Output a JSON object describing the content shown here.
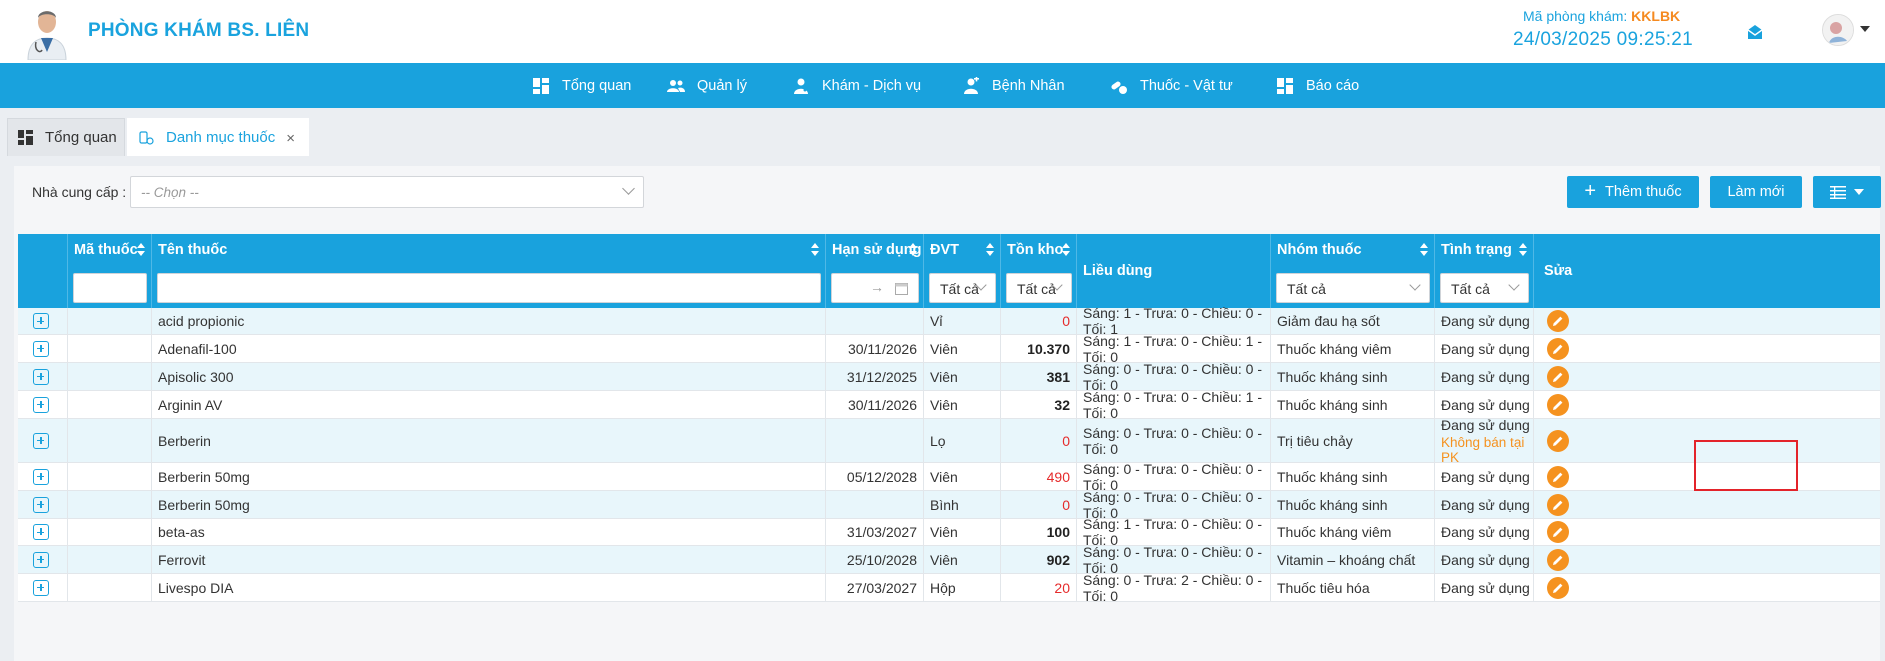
{
  "header": {
    "clinic_name": "PHÒNG KHÁM BS. LIÊN",
    "room_code_label": "Mã phòng khám: ",
    "room_code": "KKLBK",
    "datetime": "24/03/2025 09:25:21"
  },
  "nav": [
    {
      "label": "Tổng quan",
      "icon": "dashboard-icon"
    },
    {
      "label": "Quản lý",
      "icon": "users-icon"
    },
    {
      "label": "Khám - Dịch vụ",
      "icon": "doctor-icon"
    },
    {
      "label": "Bệnh Nhân",
      "icon": "patient-icon"
    },
    {
      "label": "Thuốc - Vật tư",
      "icon": "pills-icon"
    },
    {
      "label": "Báo cáo",
      "icon": "report-icon"
    }
  ],
  "tabs": {
    "overview": "Tổng quan",
    "drug_catalog": "Danh mục thuốc",
    "close": "×"
  },
  "filter": {
    "supplier_label": "Nhà cung cấp :",
    "supplier_placeholder": "-- Chọn --"
  },
  "toolbar": {
    "add_label": "Thêm thuốc",
    "refresh_label": "Làm mới"
  },
  "table": {
    "columns": {
      "code": "Mã thuốc",
      "name": "Tên thuốc",
      "expiry": "Hạn sử dụng",
      "unit": "ĐVT",
      "stock": "Tồn kho",
      "dosage": "Liều dùng",
      "group": "Nhóm thuốc",
      "status": "Tình trạng",
      "edit": "Sửa"
    },
    "filters": {
      "unit": "Tất cả",
      "stock": "Tất cả",
      "group": "Tất cả",
      "status": "Tất cả",
      "date_arrow": "→"
    },
    "rows": [
      {
        "code": "",
        "name": "acid propionic",
        "expiry": "",
        "unit": "Vỉ",
        "stock": "0",
        "dosage": "Sáng: 1 - Trưa: 0 - Chiều: 0 - Tối: 1",
        "group": "Giảm đau hạ sốt",
        "status": "Đang sử dụng",
        "status_note": ""
      },
      {
        "code": "",
        "name": "Adenafil-100",
        "expiry": "30/11/2026",
        "unit": "Viên",
        "stock": "10.370",
        "dosage": "Sáng: 1 - Trưa: 0 - Chiều: 1 - Tối: 0",
        "group": "Thuốc kháng viêm",
        "status": "Đang sử dụng",
        "status_note": ""
      },
      {
        "code": "",
        "name": "Apisolic 300",
        "expiry": "31/12/2025",
        "unit": "Viên",
        "stock": "381",
        "dosage": "Sáng: 0 - Trưa: 0 - Chiều: 0 - Tối: 0",
        "group": "Thuốc kháng sinh",
        "status": "Đang sử dụng",
        "status_note": ""
      },
      {
        "code": "",
        "name": "Arginin AV",
        "expiry": "30/11/2026",
        "unit": "Viên",
        "stock": "32",
        "dosage": "Sáng: 0 - Trưa: 0 - Chiều: 1 - Tối: 0",
        "group": "Thuốc kháng sinh",
        "status": "Đang sử dụng",
        "status_note": ""
      },
      {
        "code": "",
        "name": "Berberin",
        "expiry": "",
        "unit": "Lọ",
        "stock": "0",
        "dosage": "Sáng: 0 - Trưa: 0 - Chiều: 0 - Tối: 0",
        "group": "Trị tiêu chảy",
        "status": "Đang sử dụng",
        "status_note": "Không bán tại PK"
      },
      {
        "code": "",
        "name": "Berberin 50mg",
        "expiry": "05/12/2028",
        "unit": "Viên",
        "stock": "490",
        "dosage": "Sáng: 0 - Trưa: 0 - Chiều: 0 - Tối: 0",
        "group": "Thuốc kháng sinh",
        "status": "Đang sử dụng",
        "status_note": ""
      },
      {
        "code": "",
        "name": "Berberin 50mg",
        "expiry": "",
        "unit": "Bình",
        "stock": "0",
        "dosage": "Sáng: 0 - Trưa: 0 - Chiều: 0 - Tối: 0",
        "group": "Thuốc kháng sinh",
        "status": "Đang sử dụng",
        "status_note": ""
      },
      {
        "code": "",
        "name": "beta-as",
        "expiry": "31/03/2027",
        "unit": "Viên",
        "stock": "100",
        "dosage": "Sáng: 1 - Trưa: 0 - Chiều: 0 - Tối: 0",
        "group": "Thuốc kháng viêm",
        "status": "Đang sử dụng",
        "status_note": ""
      },
      {
        "code": "",
        "name": "Ferrovit",
        "expiry": "25/10/2028",
        "unit": "Viên",
        "stock": "902",
        "dosage": "Sáng: 0 - Trưa: 0 - Chiều: 0 - Tối: 0",
        "group": "Vitamin – khoáng chất",
        "status": "Đang sử dụng",
        "status_note": ""
      },
      {
        "code": "",
        "name": "Livespo DIA",
        "expiry": "27/03/2027",
        "unit": "Hộp",
        "stock": "20",
        "dosage": "Sáng: 0 - Trưa: 2 - Chiều: 0 - Tối: 0",
        "group": "Thuốc tiêu hóa",
        "status": "Đang sử dụng",
        "status_note": ""
      }
    ]
  },
  "colors": {
    "primary": "#19a2dd",
    "accent": "#f5921f",
    "danger": "#e52b2b"
  }
}
